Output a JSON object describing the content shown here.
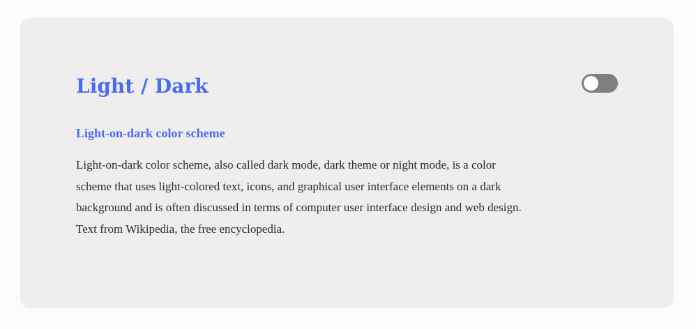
{
  "card": {
    "title": "Light / Dark",
    "subtitle": "Light-on-dark color scheme",
    "paragraph": "Light-on-dark color scheme, also called dark mode, dark theme or night mode, is a color scheme that uses light-colored text, icons, and graphical user interface elements on a dark background and is often discussed in terms of computer user interface design and web design. Text from Wikipedia, the free encyclopedia."
  },
  "toggle": {
    "state": "off"
  },
  "colors": {
    "accent": "#4a6cf5",
    "card_background": "#efeeed",
    "page_background": "#fcfcfc",
    "toggle_track": "#7f7f7f",
    "text": "#2b2b2b"
  }
}
